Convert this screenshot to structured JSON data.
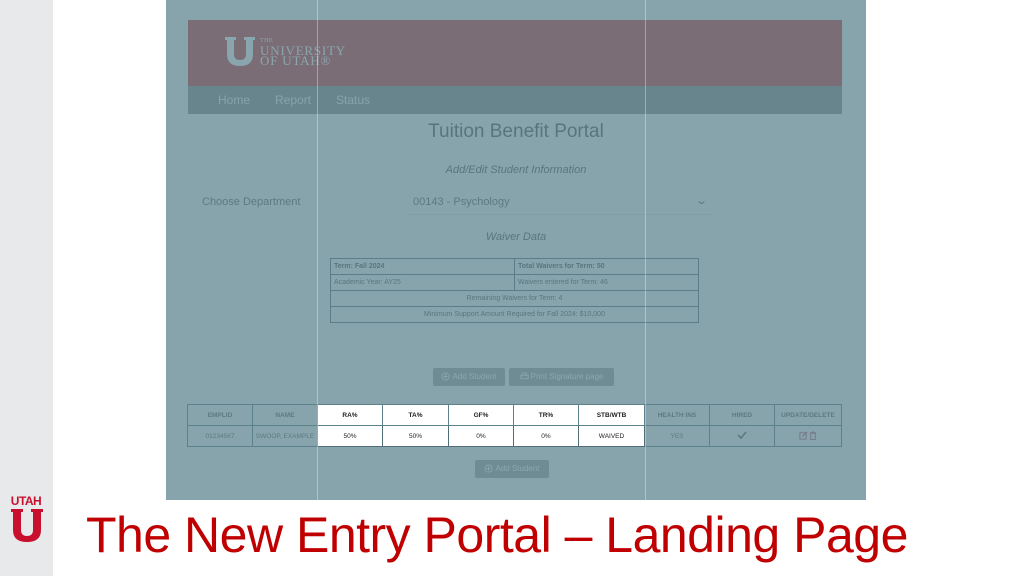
{
  "slide": {
    "title": "The New Entry Portal – Landing Page",
    "logo_word": "UTAH"
  },
  "portal": {
    "university_logo": {
      "line1": "THE",
      "line2": "UNIVERSITY",
      "line3": "OF UTAH®"
    },
    "nav": [
      "Home",
      "Report",
      "Status"
    ],
    "title": "Tuition Benefit Portal",
    "subtitle": "Add/Edit Student Information",
    "department_label": "Choose Department",
    "department_value": "00143 - Psychology",
    "waiver_heading": "Waiver Data",
    "waiver": {
      "term": "Term: Fall 2024",
      "total_waivers": "Total Waivers for Term: 50",
      "academic_year": "Academic Year: AY25",
      "waivers_entered": "Waivers entered for Term: 46",
      "remaining": "Remaining Waivers for Term: 4",
      "minimum_support": "Minimum Support Amount Required for Fall 2024: $10,000"
    },
    "buttons": {
      "add_student": "Add Student",
      "print_signature": "Print Signature page",
      "add_student_bottom": "Add Student"
    },
    "student_table": {
      "headers": [
        "EMPLID",
        "NAME",
        "RA%",
        "TA%",
        "GF%",
        "TR%",
        "STB/WTB",
        "HEALTH INS",
        "HIRED",
        "UPDATE/DELETE"
      ],
      "row": [
        "01234567",
        "SWOOP, EXAMPLE",
        "50%",
        "50%",
        "0%",
        "0%",
        "WAIVED",
        "YES",
        "",
        ""
      ]
    }
  },
  "colors": {
    "header_red": "#be0000",
    "nav_gray": "#6a6a6a",
    "title_red": "#c00000",
    "overlay_teal": "#688c96"
  }
}
